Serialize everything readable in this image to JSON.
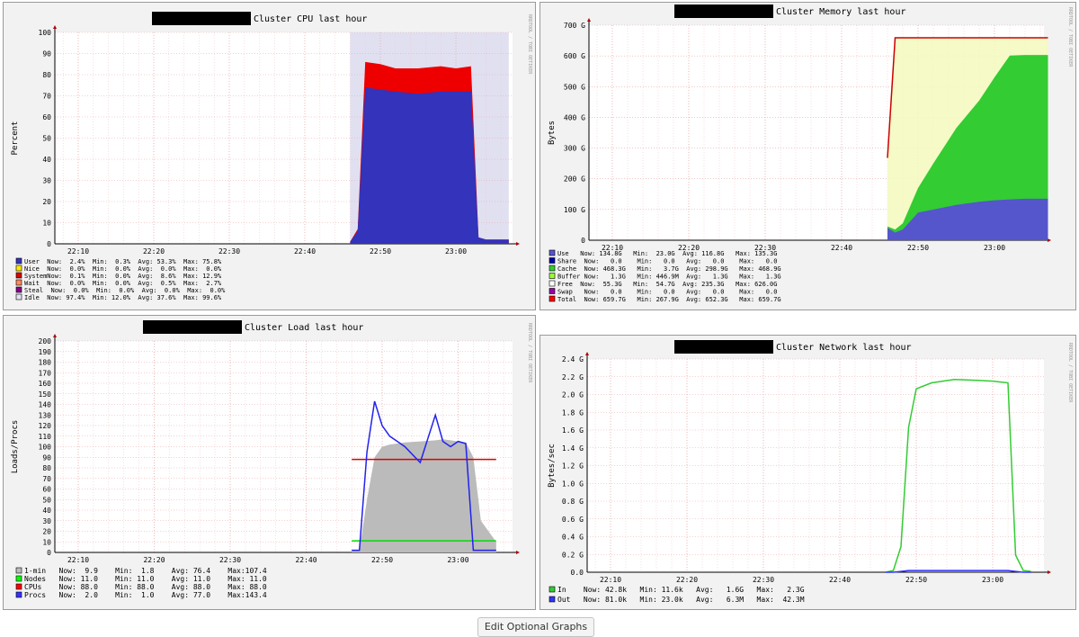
{
  "charts": [
    {
      "title": "Cluster CPU last hour",
      "ylabel": "Percent",
      "side_label": "RRDTOOL / TOBI OETIKER",
      "type": "area",
      "ylim": [
        0,
        100
      ],
      "yticks": [
        "0",
        "10",
        "20",
        "30",
        "40",
        "50",
        "60",
        "70",
        "80",
        "90",
        "100"
      ],
      "xticks": [
        "22:10",
        "22:20",
        "22:30",
        "22:40",
        "22:50",
        "23:00"
      ],
      "legend_rows": [
        {
          "color": "#3333bb",
          "text": "User  Now:  2.4%  Min:  0.3%  Avg: 53.3%  Max: 75.8%"
        },
        {
          "color": "#ffea00",
          "text": "Nice  Now:  0.0%  Min:  0.0%  Avg:  0.0%  Max:  0.0%"
        },
        {
          "color": "#dd0000",
          "text": "SystemNow:  0.1%  Min:  0.0%  Avg:  8.6%  Max: 12.9%"
        },
        {
          "color": "#ff8a60",
          "text": "Wait  Now:  0.0%  Min:  0.0%  Avg:  0.5%  Max:  2.7%"
        },
        {
          "color": "#880088",
          "text": "Steal  Now:  0.0%  Min:  0.0%  Avg:  0.0%  Max:  0.0%"
        },
        {
          "color": "#e2e2f2",
          "text": "Idle  Now: 97.4%  Min: 12.0%  Avg: 37.6%  Max: 99.6%"
        }
      ]
    },
    {
      "title": "Cluster Memory last hour",
      "ylabel": "Bytes",
      "side_label": "RRDTOOL / TOBI OETIKER",
      "type": "area",
      "ylim": [
        0,
        700
      ],
      "yticks": [
        "0",
        "100 G",
        "200 G",
        "300 G",
        "400 G",
        "500 G",
        "600 G",
        "700 G"
      ],
      "xticks": [
        "22:10",
        "22:20",
        "22:30",
        "22:40",
        "22:50",
        "23:00"
      ],
      "legend_rows": [
        {
          "color": "#5555cc",
          "text": "Use   Now: 134.8G   Min:  23.0G  Avg: 116.8G   Max: 135.3G"
        },
        {
          "color": "#0000aa",
          "text": "Share  Now:   0.0    Min:   0.0   Avg:   0.0    Max:   0.0"
        },
        {
          "color": "#33cc33",
          "text": "Cache  Now: 468.3G   Min:   3.7G  Avg: 298.9G   Max: 468.9G"
        },
        {
          "color": "#99ff33",
          "text": "Buffer Now:   1.3G   Min: 446.9M  Avg:   1.3G   Max:   1.3G"
        },
        {
          "color": "#ffffff",
          "text": "Free  Now:  55.3G   Min:  54.7G  Avg: 235.3G   Max: 626.0G"
        },
        {
          "color": "#9900aa",
          "text": "Swap   Now:   0.0    Min:   0.0   Avg:   0.0    Max:   0.0"
        },
        {
          "color": "#ff0000",
          "text": "Total  Now: 659.7G   Min: 267.9G  Avg: 652.3G   Max: 659.7G"
        }
      ]
    },
    {
      "title": "Cluster Load last hour",
      "ylabel": "Loads/Procs",
      "side_label": "RRDTOOL / TOBI OETIKER",
      "type": "line",
      "ylim": [
        0,
        200
      ],
      "yticks": [
        "0",
        "10",
        "20",
        "30",
        "40",
        "50",
        "60",
        "70",
        "80",
        "90",
        "100",
        "110",
        "120",
        "130",
        "140",
        "150",
        "160",
        "170",
        "180",
        "190",
        "200"
      ],
      "xticks": [
        "22:10",
        "22:20",
        "22:30",
        "22:40",
        "22:50",
        "23:00"
      ],
      "legend_rows": [
        {
          "color": "#bbbbbb",
          "text": "1-min   Now:  9.9    Min:  1.8    Avg: 76.4    Max:107.4"
        },
        {
          "color": "#00ff00",
          "text": "Nodes   Now: 11.0    Min: 11.0    Avg: 11.0    Max: 11.0"
        },
        {
          "color": "#ff0000",
          "text": "CPUs    Now: 88.0    Min: 88.0    Avg: 88.0    Max: 88.0"
        },
        {
          "color": "#3333ff",
          "text": "Procs   Now:  2.0    Min:  1.0    Avg: 77.0    Max:143.4"
        }
      ]
    },
    {
      "title": "Cluster Network last hour",
      "ylabel": "Bytes/sec",
      "side_label": "RRDTOOL / TOBI OETIKER",
      "type": "line",
      "ylim": [
        0,
        2.5
      ],
      "yticks": [
        "0.0",
        "0.2 G",
        "0.4 G",
        "0.6 G",
        "0.8 G",
        "1.0 G",
        "1.2 G",
        "1.4 G",
        "1.6 G",
        "1.8 G",
        "2.0 G",
        "2.2 G",
        "2.4 G"
      ],
      "xticks": [
        "22:10",
        "22:20",
        "22:30",
        "22:40",
        "22:50",
        "23:00"
      ],
      "legend_rows": [
        {
          "color": "#33cc33",
          "text": "In    Now: 42.8k   Min: 11.6k   Avg:   1.6G   Max:   2.3G"
        },
        {
          "color": "#3333ff",
          "text": "Out   Now: 81.0k   Min: 23.0k   Avg:   6.3M   Max:  42.3M"
        }
      ]
    }
  ],
  "chart_data": [
    {
      "type": "area",
      "title": "Cluster CPU last hour",
      "ylabel": "Percent",
      "ylim": [
        0,
        100
      ],
      "x": [
        "22:46",
        "22:47",
        "22:48",
        "22:50",
        "22:52",
        "22:55",
        "22:58",
        "23:00",
        "23:02",
        "23:03",
        "23:04",
        "23:07"
      ],
      "series": [
        {
          "name": "User",
          "values": [
            1,
            6,
            74,
            73,
            72,
            71,
            72,
            72,
            72,
            3,
            2,
            2
          ]
        },
        {
          "name": "System",
          "values": [
            0,
            1,
            12,
            12,
            11,
            12,
            12,
            11,
            12,
            0,
            0,
            0
          ]
        },
        {
          "name": "Idle",
          "values": [
            99,
            93,
            14,
            15,
            17,
            17,
            16,
            17,
            16,
            97,
            98,
            98
          ]
        }
      ]
    },
    {
      "type": "area",
      "title": "Cluster Memory last hour",
      "ylabel": "Bytes",
      "ylim": [
        0,
        700
      ],
      "x": [
        "22:46",
        "22:47",
        "22:48",
        "22:50",
        "22:52",
        "22:55",
        "22:58",
        "23:00",
        "23:02",
        "23:04",
        "23:07"
      ],
      "series": [
        {
          "name": "Use",
          "values": [
            40,
            25,
            35,
            90,
            100,
            115,
            125,
            130,
            133,
            135,
            135
          ]
        },
        {
          "name": "Cache",
          "values": [
            5,
            10,
            20,
            80,
            150,
            250,
            330,
            400,
            468,
            468,
            468
          ]
        },
        {
          "name": "Total",
          "values": [
            268,
            659,
            659,
            659,
            659,
            659,
            659,
            659,
            659,
            659,
            659
          ]
        }
      ]
    },
    {
      "type": "line",
      "title": "Cluster Load last hour",
      "ylabel": "Loads/Procs",
      "ylim": [
        0,
        200
      ],
      "x": [
        "22:46",
        "22:47",
        "22:48",
        "22:49",
        "22:50",
        "22:51",
        "22:52",
        "22:53",
        "22:55",
        "22:57",
        "22:58",
        "22:59",
        "23:00",
        "23:01",
        "23:02",
        "23:03",
        "23:04",
        "23:05"
      ],
      "series": [
        {
          "name": "1-min",
          "values": [
            2,
            2,
            50,
            90,
            100,
            102,
            103,
            104,
            105,
            106,
            107,
            106,
            105,
            104,
            90,
            30,
            20,
            10
          ]
        },
        {
          "name": "Nodes",
          "values": [
            11,
            11,
            11,
            11,
            11,
            11,
            11,
            11,
            11,
            11,
            11,
            11,
            11,
            11,
            11,
            11,
            11,
            11
          ]
        },
        {
          "name": "CPUs",
          "values": [
            88,
            88,
            88,
            88,
            88,
            88,
            88,
            88,
            88,
            88,
            88,
            88,
            88,
            88,
            88,
            88,
            88,
            88
          ]
        },
        {
          "name": "Procs",
          "values": [
            2,
            2,
            95,
            143,
            120,
            110,
            105,
            100,
            85,
            130,
            105,
            100,
            105,
            103,
            2,
            2,
            2,
            2
          ]
        }
      ]
    },
    {
      "type": "line",
      "title": "Cluster Network last hour",
      "ylabel": "Bytes/sec",
      "ylim": [
        0,
        2.5
      ],
      "x": [
        "22:46",
        "22:47",
        "22:48",
        "22:49",
        "22:50",
        "22:52",
        "22:55",
        "22:58",
        "23:00",
        "23:02",
        "23:03",
        "23:04",
        "23:05"
      ],
      "series": [
        {
          "name": "In",
          "values": [
            0,
            0.02,
            0.3,
            1.7,
            2.15,
            2.22,
            2.26,
            2.25,
            2.24,
            2.22,
            0.2,
            0.02,
            0.01
          ]
        },
        {
          "name": "Out",
          "values": [
            0,
            0,
            0.01,
            0.02,
            0.02,
            0.02,
            0.02,
            0.02,
            0.02,
            0.02,
            0.01,
            0,
            0
          ]
        }
      ]
    }
  ],
  "button": {
    "label": "Edit Optional Graphs"
  }
}
